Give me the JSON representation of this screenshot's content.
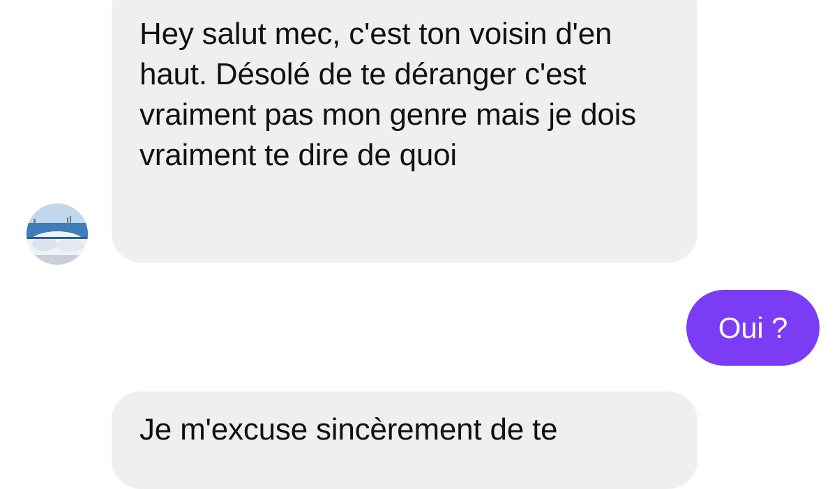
{
  "conversation": {
    "messages": [
      {
        "direction": "incoming",
        "text": "Hey salut mec, c'est ton voisin d'en haut. Désolé de te déranger c'est vraiment pas mon genre mais je dois vraiment te dire de quoi"
      },
      {
        "direction": "outgoing",
        "text": "Oui ?"
      },
      {
        "direction": "incoming",
        "text": "Je m'excuse sincèrement de te"
      }
    ],
    "contact_avatar": {
      "icon": "avatar-photo",
      "description_colors": [
        "#2f74b8",
        "#cfe0ee",
        "#e9edf1"
      ]
    }
  },
  "colors": {
    "background": "#ffffff",
    "incoming_bubble": "#efeff0",
    "incoming_text": "#111111",
    "outgoing_bubble": "#7b3cf6",
    "outgoing_text": "#ffffff"
  }
}
